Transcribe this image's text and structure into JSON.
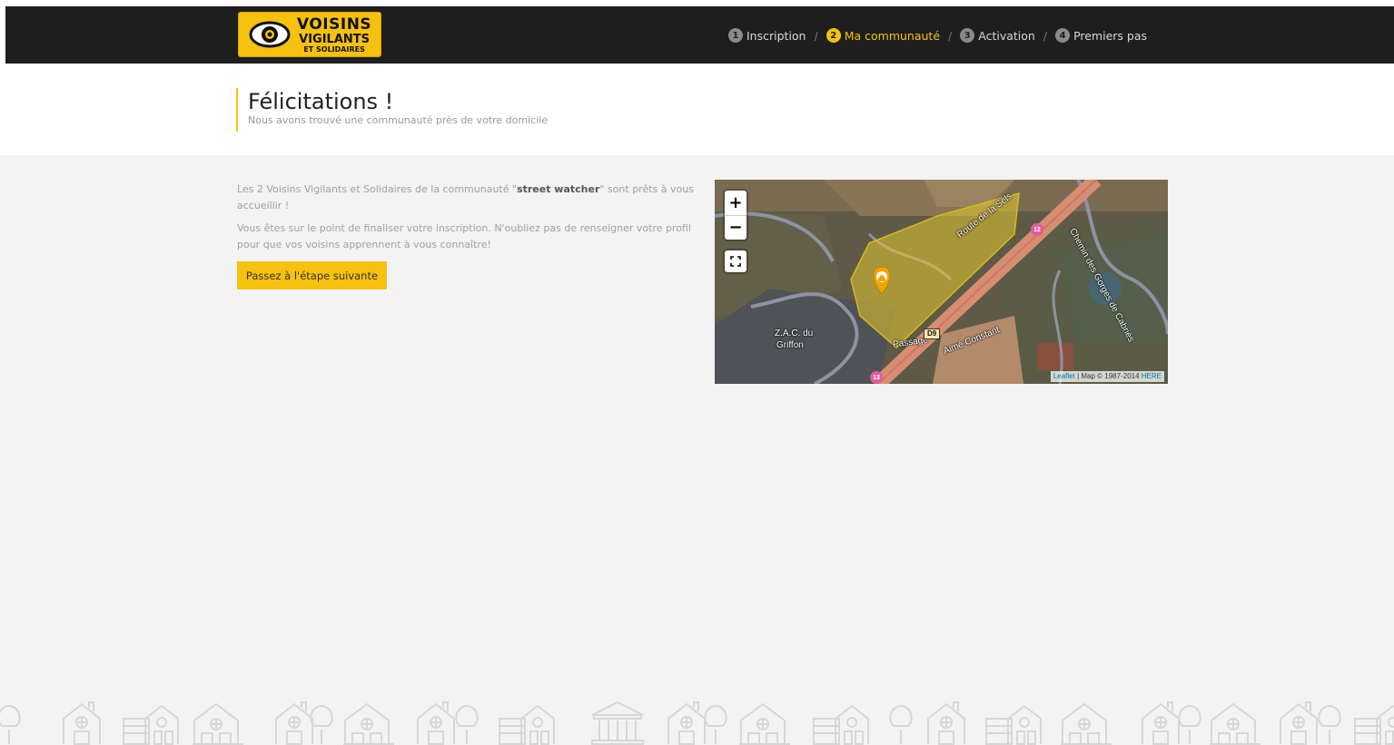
{
  "header": {
    "logo": {
      "line1": "VOISINS",
      "line2": "VIGILANTS",
      "line3": "ET SOLIDAIRES",
      "icon": "eye-icon",
      "color": "#f6c10f"
    },
    "steps": [
      {
        "num": "1",
        "label": "Inscription",
        "active": false
      },
      {
        "num": "2",
        "label": "Ma communauté",
        "active": true
      },
      {
        "num": "3",
        "label": "Activation",
        "active": false
      },
      {
        "num": "4",
        "label": "Premiers pas",
        "active": false
      }
    ],
    "separator": "/"
  },
  "title": {
    "heading": "Félicitations !",
    "subtitle": "Nous avons trouvé une communauté près de votre domicile"
  },
  "content": {
    "para1_before": "Les 2 Voisins Vigilants et Solidaires de la communauté \"",
    "community_name": "street watcher",
    "para1_after": "\" sont prêts à vous accueillir !",
    "para2": "Vous êtes sur le point de finaliser votre inscription. N'oubliez pas de renseigner votre profil pour que vos voisins apprennent à vous connaître!",
    "next_button": "Passez à l'étape suivante"
  },
  "map": {
    "zoom_in": "+",
    "zoom_out": "−",
    "fullscreen_icon": "fullscreen-icon",
    "marker_icon": "home-marker-icon",
    "labels": {
      "road1": "Route de la Sels",
      "road2": "Chemin des Gorges de Cabriès",
      "zac": "Z.A.C. du",
      "griffon": "Griffon",
      "passage": "Passage",
      "aime": "Aimé Constant"
    },
    "shields": {
      "s12": "12",
      "s13": "13",
      "d9": "D9"
    },
    "attribution_link": "Leaflet",
    "attribution_text": " | Map © 1987-2014 ",
    "attribution_link2": "HERE"
  },
  "colors": {
    "accent": "#f6c10f",
    "header_bg": "#1e1e1e",
    "panel_bg": "#f3f3f3"
  }
}
